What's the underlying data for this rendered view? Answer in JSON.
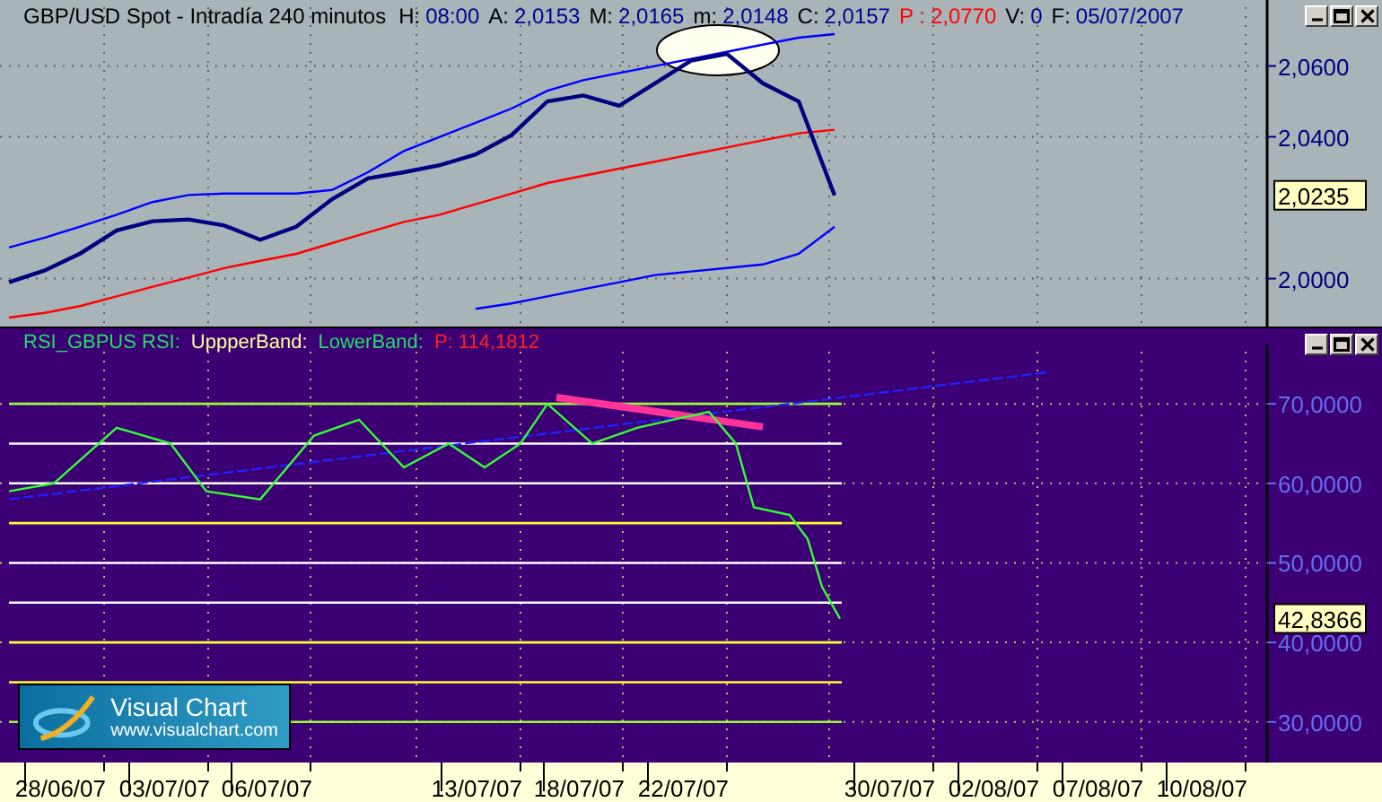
{
  "price_panel": {
    "title": "GBP/USD Spot - Intradía 240 minutos",
    "fields": [
      {
        "label": "H:",
        "value": "08:00",
        "highlight": false
      },
      {
        "label": "A:",
        "value": "2,0153",
        "highlight": false
      },
      {
        "label": "M:",
        "value": "2,0165",
        "highlight": false
      },
      {
        "label": "m:",
        "value": "2,0148",
        "highlight": false
      },
      {
        "label": "C:",
        "value": "2,0157",
        "highlight": false
      },
      {
        "label": "P :",
        "value": "2,0770",
        "highlight": true
      },
      {
        "label": "V:",
        "value": "0",
        "highlight": false
      },
      {
        "label": "F:",
        "value": "05/07/2007",
        "highlight": false
      }
    ],
    "axis_labels": [
      "2,0600",
      "2,0400",
      "2,0000"
    ],
    "last_value": "2,0235"
  },
  "rsi_panel": {
    "fields": [
      {
        "label": "RSI_GBPUS RSI:",
        "color": "#22dd66"
      },
      {
        "label": "UppperBand:",
        "color": "#ffff99"
      },
      {
        "label": "LowerBand:",
        "color": "#22dd66"
      },
      {
        "label": "P: 114,1812",
        "color": "#ff2020"
      }
    ],
    "axis_labels": [
      "70,0000",
      "60,0000",
      "50,0000",
      "40,0000",
      "30,0000"
    ],
    "last_value": "42,8366"
  },
  "date_labels": [
    "28/06/07",
    "03/07/07",
    "06/07/07",
    "13/07/07",
    "18/07/07",
    "22/07/07",
    "30/07/07",
    "02/08/07",
    "07/08/07",
    "10/08/07"
  ],
  "logo": {
    "name": "Visual Chart",
    "url": "www.visualchart.com"
  }
}
